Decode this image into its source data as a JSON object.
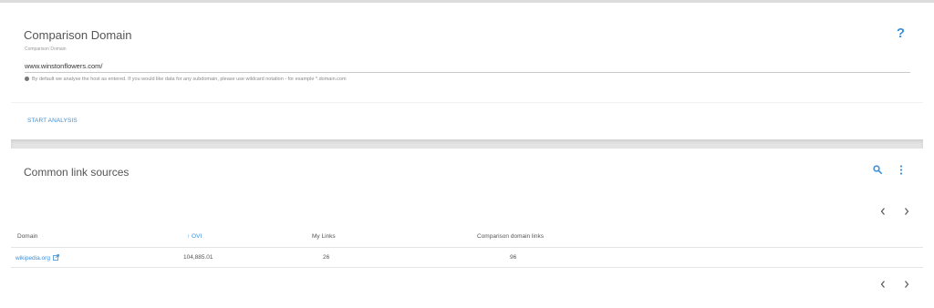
{
  "comparison": {
    "title": "Comparison Domain",
    "field_label": "Comparison Domain",
    "domain_value": "www.winstonflowers.com/",
    "hint": "By default we analyse the host as entered. If you would like data for any subdomain, please use wildcard notation - for example *.domain.com",
    "start_label": "START ANALYSIS",
    "help_label": "?"
  },
  "sources": {
    "title": "Common link sources",
    "columns": {
      "domain": "Domain",
      "ovi": "↑ OVI",
      "my_links": "My Links",
      "comparison_links": "Comparison domain links"
    },
    "rows": [
      {
        "domain": "wikipedia.org",
        "ovi": "104,885.01",
        "my_links": "26",
        "comparison_links": "96"
      }
    ]
  },
  "colors": {
    "accent": "#3c8fd6",
    "text": "#555555",
    "divider": "#e5e5e5"
  },
  "icons": [
    "help-icon",
    "info-icon",
    "search-icon",
    "more-vert-icon",
    "chevron-left-icon",
    "chevron-right-icon",
    "external-link-icon"
  ]
}
